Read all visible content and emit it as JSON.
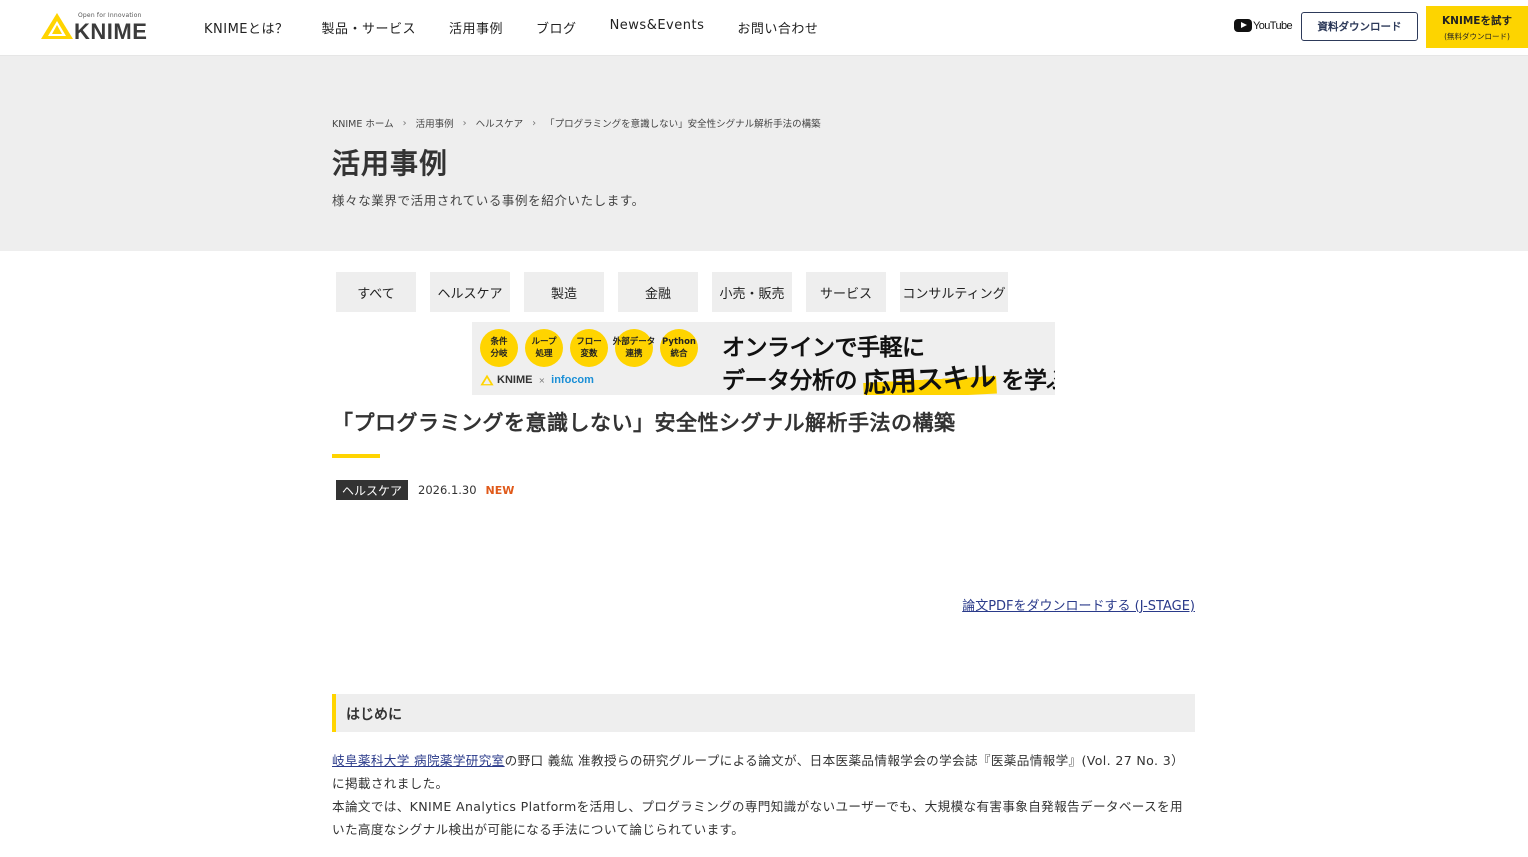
{
  "header": {
    "logo_tagline": "Open for Innovation",
    "logo_word": "KNIME",
    "nav": [
      "KNIMEとは？",
      "製品・サービス",
      "活用事例",
      "ブログ",
      "News&Events",
      "お問い合わせ"
    ],
    "youtube_label": "YouTube",
    "download_button": "資料ダウンロード",
    "try_button_line1": "KNIMEを試す",
    "try_button_line2": "(無料ダウンロード)"
  },
  "hero": {
    "breadcrumb": [
      "KNIME ホーム",
      "活用事例",
      "ヘルスケア",
      "「プログラミングを意識しない」安全性シグナル解析手法の構築"
    ],
    "title": "活用事例",
    "subtitle": "様々な業界で活用されている事例を紹介いたします。"
  },
  "filters": [
    "すべて",
    "ヘルスケア",
    "製造",
    "金融",
    "小売・販売",
    "サービス",
    "コンサルティング"
  ],
  "banner": {
    "circles": [
      [
        "条件",
        "分岐"
      ],
      [
        "ループ",
        "処理"
      ],
      [
        "フロー",
        "変数"
      ],
      [
        "外部データ",
        "連携"
      ],
      [
        "Python",
        "統合"
      ]
    ],
    "logo_knime": "KNIME",
    "logo_x": "×",
    "logo_partner": "infocom",
    "line1": "オンラインで手軽に",
    "line2_a": "データ分析の",
    "line2_highlight": "応用スキル",
    "line2_b": "を学ぶ"
  },
  "article": {
    "title": "「プログラミングを意識しない」安全性シグナル解析手法の構築",
    "category": "ヘルスケア",
    "date": "2026.1.30",
    "new_badge": "NEW",
    "pdf_link": "論文PDFをダウンロードする (J-STAGE)",
    "section_heading": "はじめに",
    "p1_link": "岐阜薬科大学 病院薬学研究室",
    "p1_text": "の野口 義紘 准教授らの研究グループによる論文が、日本医薬品情報学会の学会誌『医薬品情報学』(Vol. 27 No. 3）に掲載されました。",
    "p2_text": "本論文では、KNIME Analytics Platformを活用し、プログラミングの専門知識がないユーザーでも、大規模な有害事象自発報告データベースを用いた高度なシグナル検出が可能になる手法について論じられています。"
  },
  "colors": {
    "accent_yellow": "#ffd400",
    "link_blue": "#2a3a8a",
    "new_orange": "#e05a1a"
  }
}
